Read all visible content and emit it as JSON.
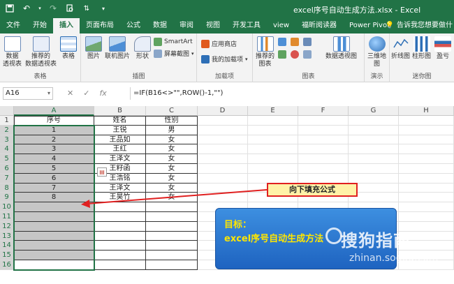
{
  "window": {
    "title": "excel序号自动生成方法.xlsx - Excel",
    "accent": "#217346"
  },
  "tabs": [
    "文件",
    "开始",
    "插入",
    "页面布局",
    "公式",
    "数据",
    "审阅",
    "视图",
    "开发工具",
    "view",
    "福昕阅读器",
    "Power Pivot"
  ],
  "active_tab": "插入",
  "tell_me": "告诉我您想要做什",
  "ribbon": {
    "groups": [
      {
        "label": "表格",
        "buttons": [
          "数据\n透视表",
          "推荐的\n数据透视表",
          "表格"
        ]
      },
      {
        "label": "插图",
        "buttons": [
          "图片",
          "联机图片",
          "形状"
        ],
        "small": [
          "SmartArt",
          "屏幕截图"
        ]
      },
      {
        "label": "加载项",
        "small": [
          "应用商店",
          "我的加载项"
        ]
      },
      {
        "label": "图表",
        "buttons": [
          "推荐的\n图表",
          "数据透视图"
        ]
      },
      {
        "label": "演示",
        "buttons": [
          "三维地\n图"
        ]
      },
      {
        "label": "迷你图",
        "buttons": [
          "折线图",
          "柱形图",
          "盈亏"
        ]
      }
    ]
  },
  "formula_bar": {
    "name_box": "A16",
    "cancel": "✕",
    "enter": "✓",
    "fx": "fx",
    "formula": "=IF(B16<>\"\",ROW()-1,\"\")"
  },
  "sheet": {
    "columns": [
      "A",
      "B",
      "C",
      "D",
      "E",
      "F",
      "G",
      "H"
    ],
    "rows": [
      "1",
      "2",
      "3",
      "4",
      "5",
      "6",
      "7",
      "8",
      "9",
      "10",
      "11",
      "12",
      "13",
      "14",
      "15",
      "16"
    ],
    "header": [
      "序号",
      "姓名",
      "性别"
    ],
    "data": [
      [
        "1",
        "王锐",
        "男"
      ],
      [
        "2",
        "王品如",
        "女"
      ],
      [
        "3",
        "王红",
        "女"
      ],
      [
        "4",
        "王泽文",
        "女"
      ],
      [
        "5",
        "王籽函",
        "女"
      ],
      [
        "6",
        "王浩铭",
        "女"
      ],
      [
        "7",
        "王泽文",
        "女"
      ],
      [
        "8",
        "王昊竹",
        "女"
      ]
    ]
  },
  "annotations": {
    "callout": "向下填充公式",
    "goal_title": "目标：",
    "goal_text": "excel序号自动生成方法",
    "watermark": "搜狗指南",
    "watermark_url": "zhinan.sogou.com"
  }
}
